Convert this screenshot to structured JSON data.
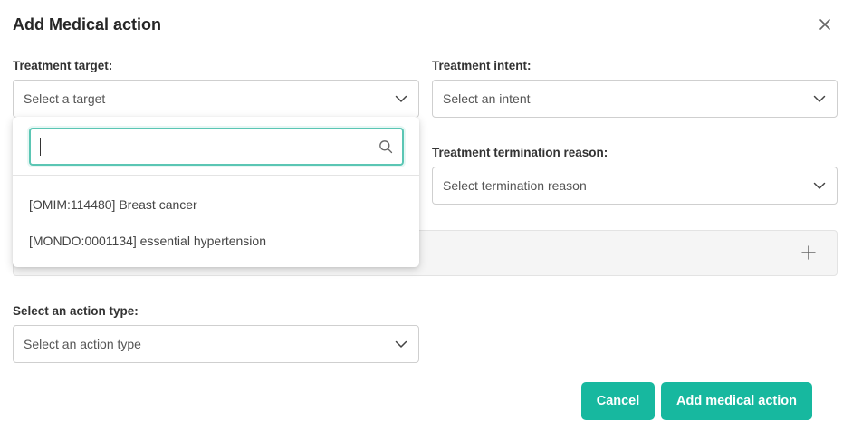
{
  "dialog": {
    "title": "Add Medical action"
  },
  "fields": {
    "treatment_target": {
      "label": "Treatment target:",
      "placeholder": "Select a target"
    },
    "treatment_intent": {
      "label": "Treatment intent:",
      "placeholder": "Select an intent"
    },
    "termination_reason": {
      "label": "Treatment termination reason:",
      "placeholder": "Select termination reason"
    },
    "action_type": {
      "label": "Select an action type:",
      "placeholder": "Select an action type"
    }
  },
  "dropdown": {
    "search_value": "",
    "options": [
      {
        "label": "[OMIM:114480] Breast cancer"
      },
      {
        "label": "[MONDO:0001134] essential hypertension"
      }
    ]
  },
  "buttons": {
    "cancel": "Cancel",
    "submit": "Add medical action"
  },
  "colors": {
    "accent": "#17b89f",
    "focus_border": "#5bc6b4"
  },
  "icons": [
    "close-icon",
    "chevron-down-icon",
    "search-icon",
    "plus-icon"
  ]
}
